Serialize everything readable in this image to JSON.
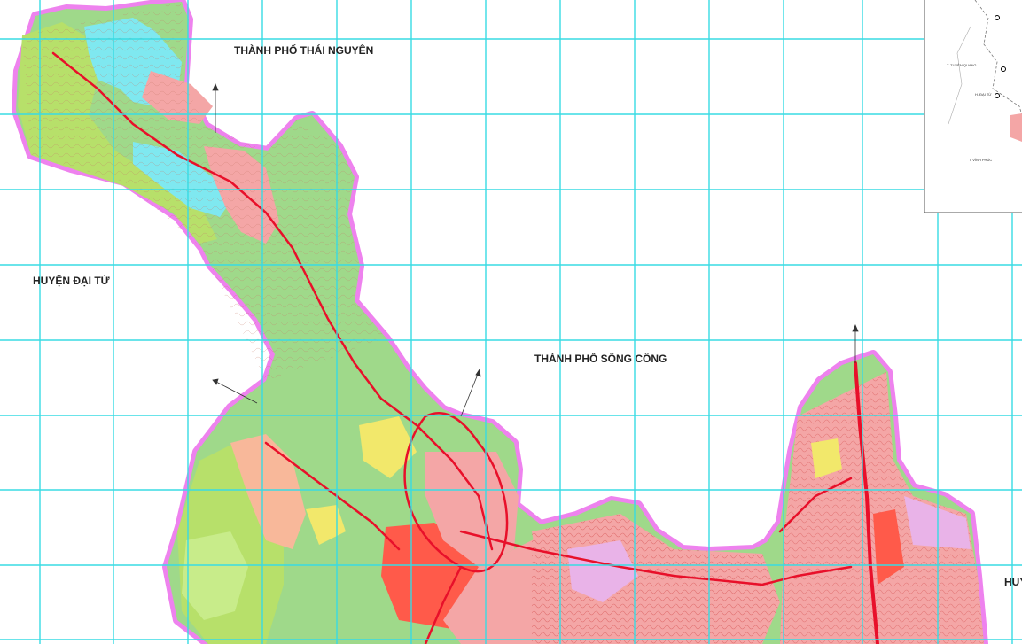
{
  "map": {
    "labels": {
      "thai_nguyen": "THÀNH PHỐ THÁI NGUYÊN",
      "dai_tu": "HUYỆN ĐẠI TỪ",
      "song_cong": "THÀNH PHỐ SÔNG CÔNG",
      "right_edge": "HUY"
    },
    "inset": {
      "labels": [
        "T. TUYÊN QUANG",
        "H. ĐẠI TỪ",
        "T. VĨNH PHÚC"
      ]
    },
    "colors": {
      "grid": "#38dbe3",
      "boundary": "#ee82ee",
      "residential": "#f4a6a6",
      "forest": "#9fd98a",
      "agriculture": "#b7e06a",
      "water": "#7fe8f0",
      "roads": "#e8102a",
      "public": "#e9b3e8",
      "industrial": "#ff5a4a",
      "yellow": "#f2e86b"
    }
  }
}
